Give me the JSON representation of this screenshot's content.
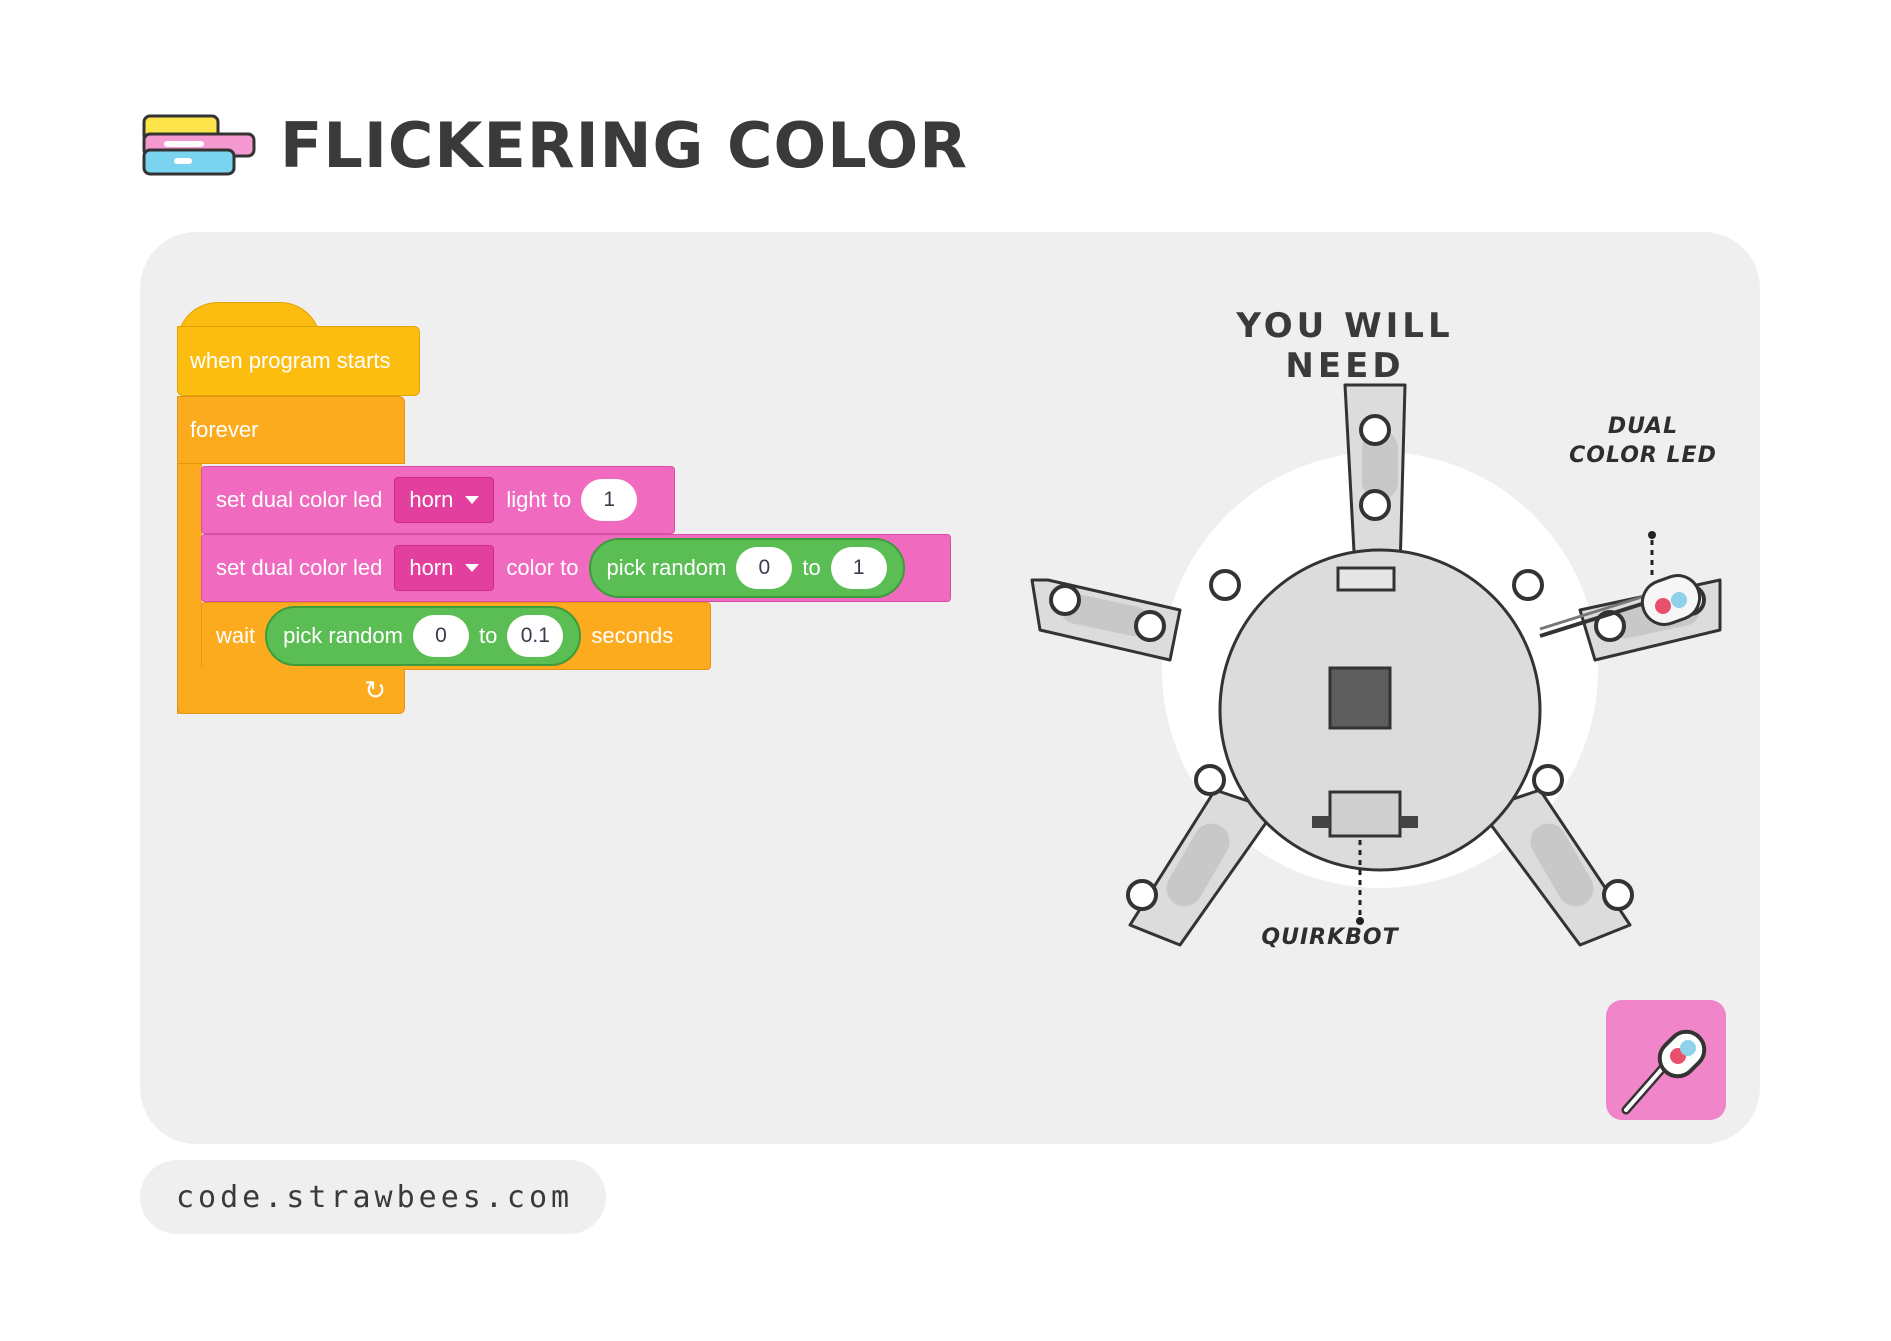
{
  "header": {
    "title": "FLICKERING COLOR",
    "icon": "code-blocks-icon"
  },
  "program": {
    "hat_label": "when program starts",
    "forever_label": "forever",
    "repeat_icon": "loop-arrow-icon",
    "statements": [
      {
        "label": "set dual color led",
        "dropdown": "horn",
        "suffix": "light to",
        "value": "1"
      },
      {
        "label": "set dual color led",
        "dropdown": "horn",
        "suffix": "color to",
        "reporter": {
          "label": "pick random",
          "from": "0",
          "to_label": "to",
          "to": "1"
        }
      },
      {
        "label": "wait",
        "reporter": {
          "label": "pick random",
          "from": "0",
          "to_label": "to",
          "to": "0.1"
        },
        "suffix": "seconds"
      }
    ]
  },
  "requirements": {
    "title": "YOU WILL NEED",
    "led_label_line1": "DUAL",
    "led_label_line2": "COLOR LED",
    "board_label": "QUIRKBOT"
  },
  "colors": {
    "hat": "#fdbd10",
    "control": "#fdab1e",
    "led_block": "#f06bbf",
    "operator": "#5bbe55",
    "badge": "#f085c9"
  },
  "footer": {
    "url": "code.strawbees.com"
  }
}
